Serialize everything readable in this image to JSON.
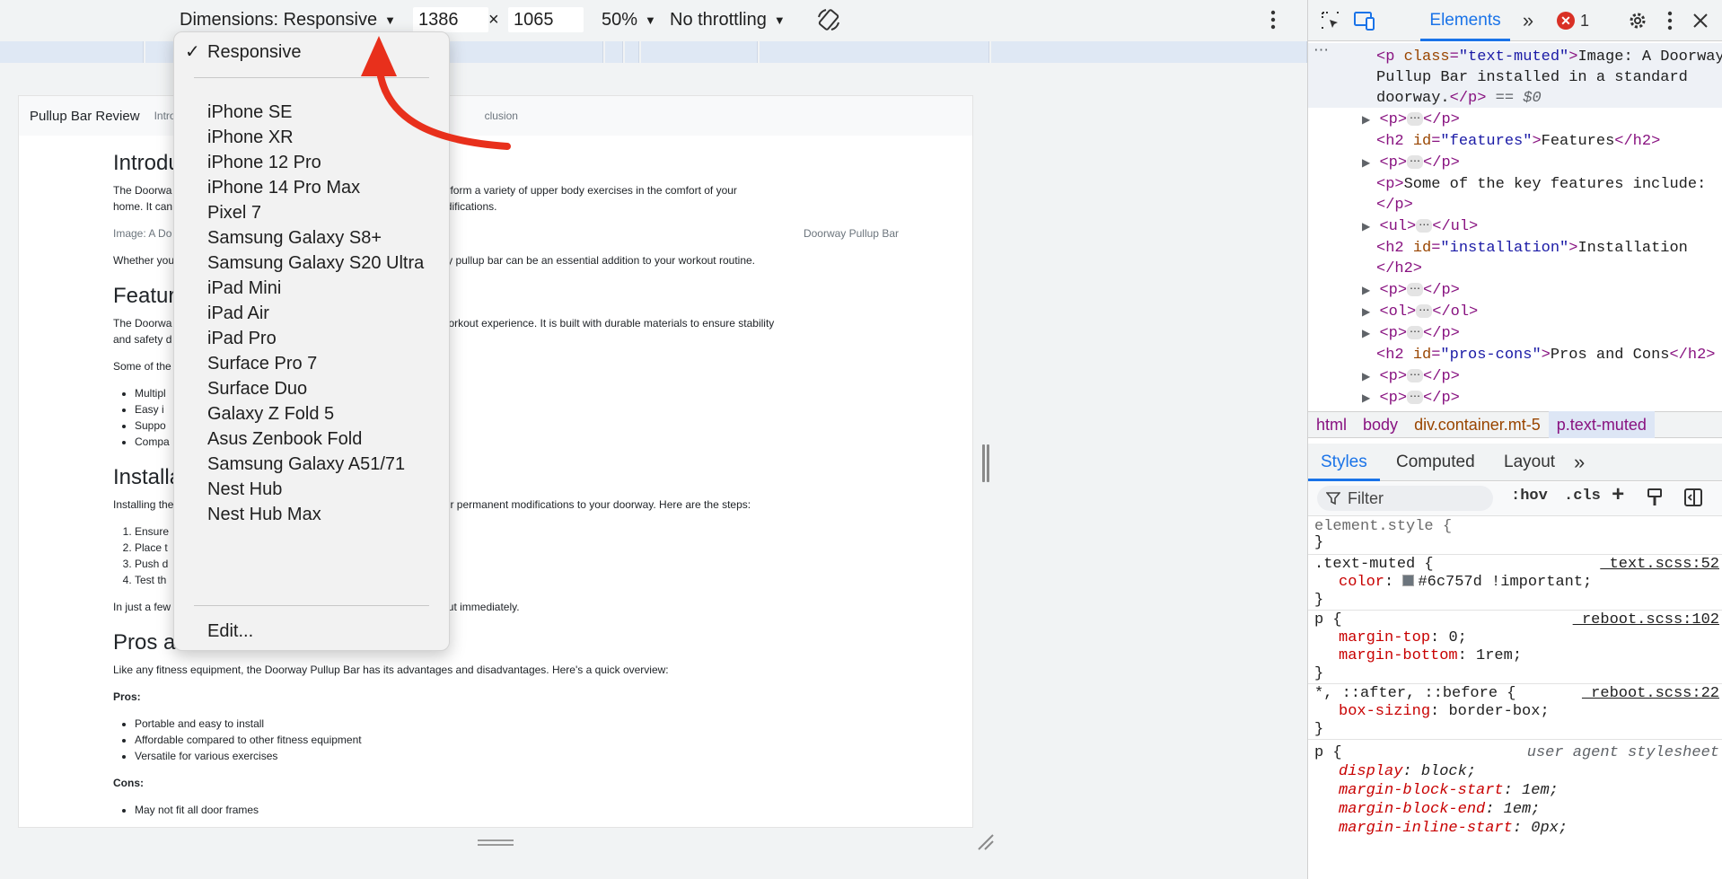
{
  "device_toolbar": {
    "dimensions_label": "Dimensions: Responsive",
    "width": "1386",
    "times": "×",
    "height": "1065",
    "zoom": "50%",
    "throttling": "No throttling"
  },
  "device_menu": {
    "selected": "Responsive",
    "devices": [
      "iPhone SE",
      "iPhone XR",
      "iPhone 12 Pro",
      "iPhone 14 Pro Max",
      "Pixel 7",
      "Samsung Galaxy S8+",
      "Samsung Galaxy S20 Ultra",
      "iPad Mini",
      "iPad Air",
      "iPad Pro",
      "Surface Pro 7",
      "Surface Duo",
      "Galaxy Z Fold 5",
      "Asus Zenbook Fold",
      "Samsung Galaxy A51/71",
      "Nest Hub",
      "Nest Hub Max"
    ],
    "edit_label": "Edit..."
  },
  "emulated_page": {
    "brand": "Pullup Bar Review",
    "nav_links": [
      "Intro",
      "clusion"
    ],
    "intro_heading": "Introdu",
    "intro_p1_line1": "The Doorwa                                                                t allows you to perform a variety of upper body exercises in the comfort of your",
    "intro_p1_line2": "home. It can                                                                or permanent modifications.",
    "image_caption": "Image: A Do",
    "image_alt": "Doorway Pullup Bar",
    "intro_p2": "Whether you                                                                stay fit, a doorway pullup bar can be an essential addition to your workout routine.",
    "features_heading": "Featur",
    "features_p1_line1": "The Doorwa                                                                o enhance your workout experience. It is built with durable materials to ensure stability",
    "features_p1_line2": "and safety d",
    "features_p2": "Some of the",
    "features_list": [
      "Multipl",
      "Easy i",
      "Suppo",
      "Compa"
    ],
    "installation_heading": "Installa",
    "installation_p1": "Installing the                                                                equires no tools or permanent modifications to your doorway. Here are the steps:",
    "installation_steps": [
      "Ensure",
      "Place t                                                      s centered.",
      "Push d",
      "Test th"
    ],
    "installation_p2": "In just a few                                                                d start your workout immediately.",
    "pros_cons_heading": "Pros and Cons",
    "pros_cons_intro": "Like any fitness equipment, the Doorway Pullup Bar has its advantages and disadvantages. Here's a quick overview:",
    "pros_label": "Pros:",
    "pros": [
      "Portable and easy to install",
      "Affordable compared to other fitness equipment",
      "Versatile for various exercises"
    ],
    "cons_label": "Cons:",
    "cons": [
      "May not fit all door frames"
    ]
  },
  "devtools": {
    "tab_elements": "Elements",
    "error_count": "1",
    "breadcrumb": [
      "html",
      "body",
      "div.container.mt-5",
      "p.text-muted"
    ],
    "style_tabs": [
      "Styles",
      "Computed",
      "Layout"
    ],
    "filter_placeholder": "Filter",
    "hov": ":hov",
    "cls": ".cls",
    "dom": {
      "selected_open": "<p class=\"text-muted\">",
      "selected_text_1": "Image: A Doorway",
      "selected_text_2": "Pullup Bar installed in a standard",
      "selected_text_3": "doorway.",
      "selected_close": "</p>",
      "selected_marker": "== $0",
      "h2_features_id": "features",
      "h2_features_text": "Features",
      "p_key_features": "Some of the key features include:",
      "h2_installation_id": "installation",
      "h2_installation_text": "Installation",
      "h2_pros_id": "pros-cons",
      "h2_pros_text": "Pros and Cons"
    },
    "styles": {
      "element_style": "element.style {",
      "text_muted_selector": ".text-muted {",
      "text_muted_source": "_text.scss:52",
      "text_muted_prop": "color",
      "text_muted_value": "#6c757d !important;",
      "text_muted_color": "#6c757d",
      "p_selector": "p {",
      "p_source": "_reboot.scss:102",
      "margin_top_prop": "margin-top",
      "margin_top_value": "0;",
      "margin_bottom_prop": "margin-bottom",
      "margin_bottom_value": "1rem;",
      "universal_selector": "*, ::after, ::before {",
      "universal_source": "_reboot.scss:22",
      "box_sizing_prop": "box-sizing",
      "box_sizing_value": "border-box;",
      "ua_selector": "p {",
      "ua_source": "user agent stylesheet",
      "display_prop": "display",
      "display_value": "block;",
      "mbs_prop": "margin-block-start",
      "mbs_value": "1em;",
      "mbe_prop": "margin-block-end",
      "mbe_value": "1em;",
      "mis_prop": "margin-inline-start",
      "mis_value": "0px;"
    }
  },
  "colors": {
    "accent": "#1a73e8",
    "annotation_arrow": "#e8301c",
    "error": "#d93025"
  }
}
